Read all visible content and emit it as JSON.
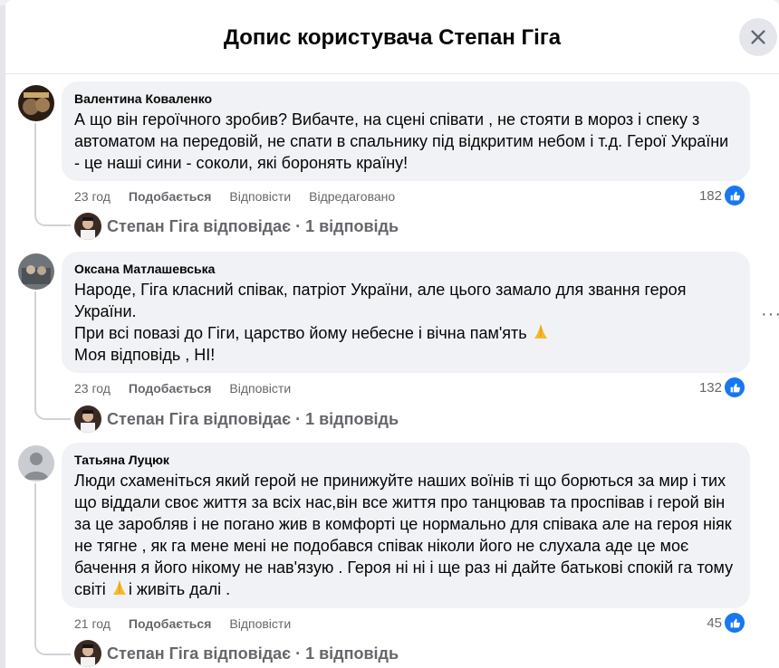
{
  "dialog": {
    "title": "Допис користувача Степан Гіга",
    "close_icon": "close-icon"
  },
  "comments": [
    {
      "author": "Валентина Коваленко",
      "text": "А що він героїчного зробив? Вибачте, на сцені співати , не стояти в мороз і спеку з автоматом на передовій, не спати в спальнику під відкритим небом і т.д. Герої України - це наші сини - соколи, які боронять країну!",
      "time": "23 год",
      "like_label": "Подобається",
      "reply_label": "Відповісти",
      "edited_label": "Відредаговано",
      "reaction_count": "182",
      "reply_summary": "Степан Гіга відповідає · 1 відповідь"
    },
    {
      "author": "Оксана Матлашевська",
      "text_lines": [
        "Народе, Гіга класний співак, патріот України, але цього замало для звання героя України.",
        "При всі повазі до Гіги, царство йому небесне і вічна пам'ять",
        "Моя відповідь , НІ!"
      ],
      "time": "23 год",
      "like_label": "Подобається",
      "reply_label": "Відповісти",
      "reaction_count": "132",
      "reply_summary": "Степан Гіга відповідає · 1 відповідь"
    },
    {
      "author": "Татьяна Луцюк",
      "text_before_emoji": "Люди схаменіться який герой не принижуйте наших воїнів ті що борються за мир і тих що віддали своє життя за всіх нас,він все життя про танцював та проспівав і герой він за це заробляв і не погано жив в комфорті це нормально для співака але на героя ніяк не тягне , як га мене мені не подобався співак ніколи його не слухала аде це моє бачення я його нікому не нав'язую . Героя ні ні і ще раз ні дайте батькові спокій га тому світі",
      "text_after_emoji": "і живіть далі .",
      "time": "21 год",
      "like_label": "Подобається",
      "reply_label": "Відповісти",
      "reaction_count": "45",
      "reply_summary": "Степан Гіга відповідає · 1 відповідь"
    }
  ],
  "more_options": "···"
}
